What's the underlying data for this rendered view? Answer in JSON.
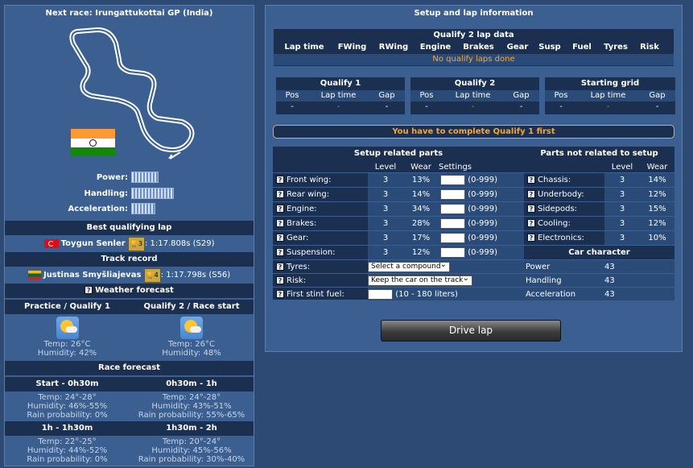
{
  "left": {
    "next_race": "Next race: Irungattukottai GP (India)",
    "power_label": "Power:",
    "handling_label": "Handling:",
    "acceleration_label": "Acceleration:",
    "power_level": 0.5,
    "handling_level": 0.75,
    "acceleration_level": 0.5,
    "best_qual_title": "Best qualifying lap",
    "best_qual_driver": "Toygun Senler",
    "best_qual_badge": "3",
    "best_qual_time": ":  1:17.808s  (S29)",
    "track_record_title": "Track record",
    "track_record_driver": "Justinas Smyšliajevas",
    "track_record_badge": "4",
    "track_record_time": ":  1:17.798s  (S56)",
    "weather_title": "Weather forecast",
    "pq1_title": "Practice / Qualify 1",
    "q2_title": "Qualify 2 / Race start",
    "pq1_temp": "Temp: 26°C",
    "pq1_hum": "Humidity: 42%",
    "q2_temp": "Temp: 26°C",
    "q2_hum": "Humidity: 48%",
    "race_forecast_title": "Race forecast",
    "rf": [
      {
        "title": "Start - 0h30m",
        "temp": "Temp: 24°-28°",
        "hum": "Humidity: 46%-55%",
        "rain": "Rain probability: 0%"
      },
      {
        "title": "0h30m - 1h",
        "temp": "Temp: 24°-28°",
        "hum": "Humidity: 43%-51%",
        "rain": "Rain probability: 55%-65%"
      },
      {
        "title": "1h - 1h30m",
        "temp": "Temp: 22°-25°",
        "hum": "Humidity: 44%-52%",
        "rain": "Rain probability: 0%"
      },
      {
        "title": "1h30m - 2h",
        "temp": "Temp: 20°-24°",
        "hum": "Humidity: 45%-56%",
        "rain": "Rain probability: 30%-40%"
      }
    ]
  },
  "right": {
    "title": "Setup and lap information",
    "q2_title": "Qualify 2 lap data",
    "q2_cols": [
      "Lap time",
      "FWing",
      "RWing",
      "Engine",
      "Brakes",
      "Gear",
      "Susp",
      "Fuel",
      "Tyres",
      "Risk"
    ],
    "q2_empty": "No qualify laps done",
    "boxes": [
      {
        "title": "Qualify 1",
        "cols": [
          "Pos",
          "Lap time",
          "Gap"
        ],
        "vals": [
          "-",
          "-",
          "-"
        ]
      },
      {
        "title": "Qualify 2",
        "cols": [
          "Pos",
          "Lap time",
          "Gap"
        ],
        "vals": [
          "-",
          "-",
          "-"
        ]
      },
      {
        "title": "Starting grid",
        "cols": [
          "Pos",
          "Lap time",
          "Gap"
        ],
        "vals": [
          "-",
          "-",
          "-"
        ]
      }
    ],
    "notice": "You have to complete Qualify 1 first",
    "setup_title": "Setup related parts",
    "nonsetup_title": "Parts not related to setup",
    "col_level": "Level",
    "col_wear": "Wear",
    "col_settings": "Settings",
    "setup_parts": [
      {
        "name": "Front wing:",
        "level": "3",
        "wear": "13%",
        "range": "(0-999)"
      },
      {
        "name": "Rear wing:",
        "level": "3",
        "wear": "14%",
        "range": "(0-999)"
      },
      {
        "name": "Engine:",
        "level": "3",
        "wear": "34%",
        "range": "(0-999)"
      },
      {
        "name": "Brakes:",
        "level": "3",
        "wear": "28%",
        "range": "(0-999)"
      },
      {
        "name": "Gear:",
        "level": "3",
        "wear": "17%",
        "range": "(0-999)"
      },
      {
        "name": "Suspension:",
        "level": "3",
        "wear": "12%",
        "range": "(0-999)"
      }
    ],
    "nonsetup_parts": [
      {
        "name": "Chassis:",
        "level": "3",
        "wear": "14%"
      },
      {
        "name": "Underbody:",
        "level": "3",
        "wear": "12%"
      },
      {
        "name": "Sidepods:",
        "level": "3",
        "wear": "15%"
      },
      {
        "name": "Cooling:",
        "level": "3",
        "wear": "12%"
      },
      {
        "name": "Electronics:",
        "level": "3",
        "wear": "10%"
      }
    ],
    "tyres_label": "Tyres:",
    "tyres_value": "Select a compound",
    "risk_label": "Risk:",
    "risk_value": "Keep the car on the track",
    "fuel_label": "First stint fuel:",
    "fuel_range": "(10 - 180 liters)",
    "char_title": "Car character",
    "char": [
      {
        "name": "Power",
        "value": "43"
      },
      {
        "name": "Handling",
        "value": "43"
      },
      {
        "name": "Acceleration",
        "value": "43"
      }
    ],
    "drive_button": "Drive lap"
  }
}
